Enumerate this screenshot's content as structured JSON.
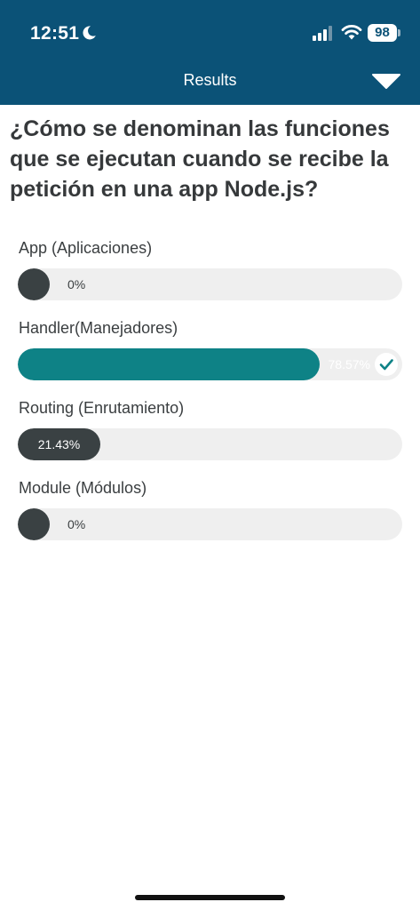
{
  "status_bar": {
    "time": "12:51",
    "battery": "98",
    "icons": [
      "moon-icon",
      "signal-icon",
      "wifi-icon",
      "battery-icon"
    ]
  },
  "header": {
    "title": "Results",
    "dropdown_icon": "chevron-down-icon",
    "background_color": "#0b5277"
  },
  "question": "¿Cómo se denominan las funciones que se ejecutan cuando se recibe la petición en una app Node.js?",
  "options": [
    {
      "label": "App (Aplicaciones)",
      "percent_text": "0%",
      "fraction": 0.0,
      "correct": false
    },
    {
      "label": "Handler(Manejadores)",
      "percent_text": "78.57%",
      "fraction": 0.7857,
      "correct": true
    },
    {
      "label": "Routing (Enrutamiento)",
      "percent_text": "21.43%",
      "fraction": 0.2143,
      "correct": false
    },
    {
      "label": "Module (Módulos)",
      "percent_text": "0%",
      "fraction": 0.0,
      "correct": false
    }
  ],
  "colors": {
    "correct_fill": "#0e8286",
    "default_fill": "#3a4143",
    "track": "#efefef"
  }
}
